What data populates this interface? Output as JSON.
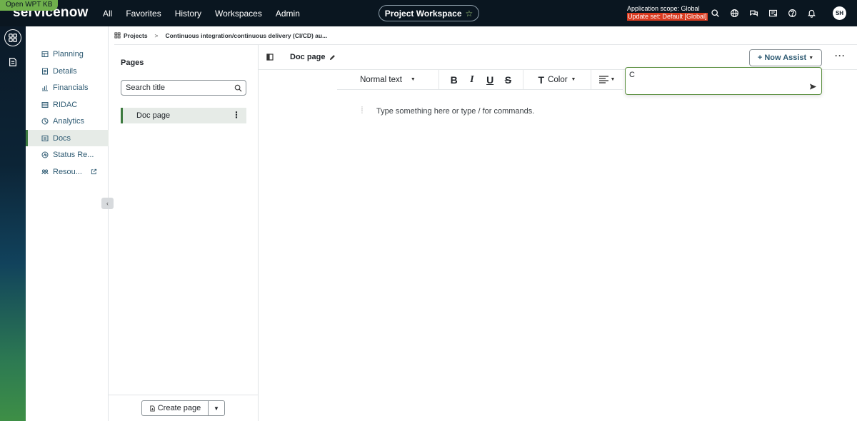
{
  "kb_badge": "Open WPT KB",
  "logo": "servicenow",
  "nav": {
    "items": [
      "All",
      "Favorites",
      "History",
      "Workspaces",
      "Admin"
    ]
  },
  "workspace": {
    "label": "Project Workspace",
    "star": "☆"
  },
  "scope": {
    "application": "Application scope: Global",
    "update_set": "Update set: Default [Global]"
  },
  "user": {
    "initials": "SH"
  },
  "breadcrumb": {
    "root": "Projects",
    "separator": ">",
    "current": "Continuous integration/continuous delivery (CI/CD) au..."
  },
  "modules": {
    "items": [
      {
        "label": "Planning"
      },
      {
        "label": "Details"
      },
      {
        "label": "Financials"
      },
      {
        "label": "RIDAC"
      },
      {
        "label": "Analytics"
      },
      {
        "label": "Docs"
      },
      {
        "label": "Status Re..."
      },
      {
        "label": "Resou..."
      }
    ]
  },
  "pages": {
    "title": "Pages",
    "search_value": "Search title",
    "items": [
      {
        "label": "Doc page"
      }
    ],
    "create_label": "Create page"
  },
  "doc": {
    "title": "Doc page",
    "now_assist": "+ Now Assist",
    "more": "···",
    "placeholder": "Type something here or type / for commands."
  },
  "toolbar": {
    "text_style": "Normal text",
    "bold": "B",
    "italic": "I",
    "underline": "U",
    "strike": "S",
    "color_glyph": "T",
    "color_label": "Color"
  },
  "assist_prompt": {
    "value": "C"
  },
  "colors": {
    "topbar": "#0a1620",
    "accent_green": "#3c7a3f",
    "link_blue": "#2f5b73",
    "update_set_red": "#d83a1f",
    "kb_badge": "#6fb04c"
  },
  "icons": {
    "rail": [
      "workspace-grid-icon",
      "document-icon"
    ],
    "top": [
      "search-icon",
      "globe-icon",
      "chat-icon",
      "list-check-icon",
      "help-icon",
      "bell-icon"
    ]
  }
}
